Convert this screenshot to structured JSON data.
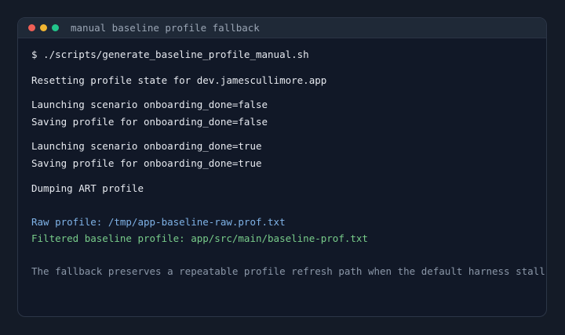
{
  "window": {
    "title": "manual baseline profile fallback",
    "controls": {
      "close_color": "#ef5f56",
      "minimize_color": "#f2b632",
      "maximize_color": "#22c58b"
    }
  },
  "terminal": {
    "command": "$ ./scripts/generate_baseline_profile_manual.sh",
    "reset": "Resetting profile state for dev.jamescullimore.app",
    "launch_false": "Launching scenario onboarding_done=false",
    "save_false": "Saving profile for onboarding_done=false",
    "launch_true": "Launching scenario onboarding_done=true",
    "save_true": "Saving profile for onboarding_done=true",
    "dump": "Dumping ART profile",
    "raw_profile": "Raw profile: /tmp/app-baseline-raw.prof.txt",
    "filtered_profile": "Filtered baseline profile: app/src/main/baseline-prof.txt",
    "note": "The fallback preserves a repeatable profile refresh path when the default harness stalls."
  },
  "colors": {
    "background": "#141b27",
    "terminal_bg": "#111827",
    "titlebar_bg": "#1f2937",
    "text": "#e6e9ef",
    "raw_profile": "#7fb2e6",
    "filtered_profile": "#78cc8a",
    "note": "#8b97a8"
  }
}
